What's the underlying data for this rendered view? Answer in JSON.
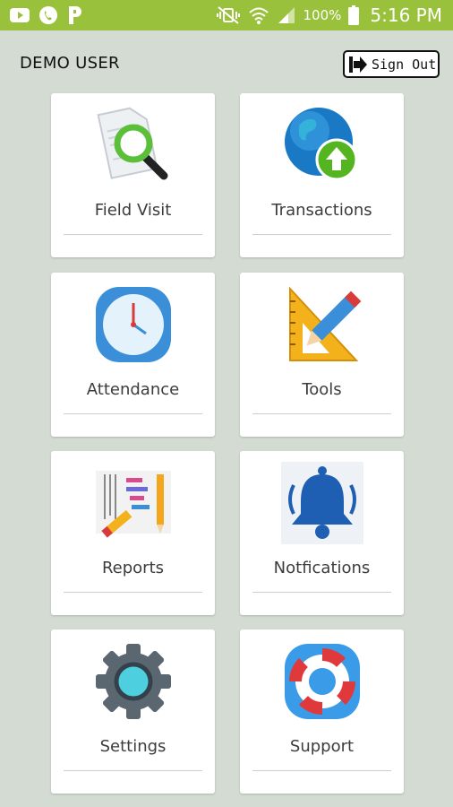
{
  "status_bar": {
    "left_icons": [
      "youtube-icon",
      "phone-icon",
      "parking-icon"
    ],
    "right_icons": [
      "mute-vibrate-icon",
      "wifi-icon",
      "signal-icon",
      "battery-icon"
    ],
    "battery": "100%",
    "time": "5:16 PM",
    "color": "#9ac13b"
  },
  "header": {
    "user": "DEMO USER",
    "signout_label": "Sign Out",
    "signout_icon": "logout-arrow-icon"
  },
  "tiles": [
    {
      "label": "Field Visit",
      "icon": "document-search-icon"
    },
    {
      "label": "Transactions",
      "icon": "globe-upload-icon"
    },
    {
      "label": "Attendance",
      "icon": "clock-icon"
    },
    {
      "label": "Tools",
      "icon": "set-square-pencil-icon"
    },
    {
      "label": "Reports",
      "icon": "reports-chart-icon"
    },
    {
      "label": "Notfications",
      "icon": "bell-icon"
    },
    {
      "label": "Settings",
      "icon": "gear-icon"
    },
    {
      "label": "Support",
      "icon": "lifebuoy-icon"
    }
  ],
  "colors": {
    "background": "#d3dbd3",
    "tile": "#ffffff",
    "text": "#3c3c3c"
  }
}
